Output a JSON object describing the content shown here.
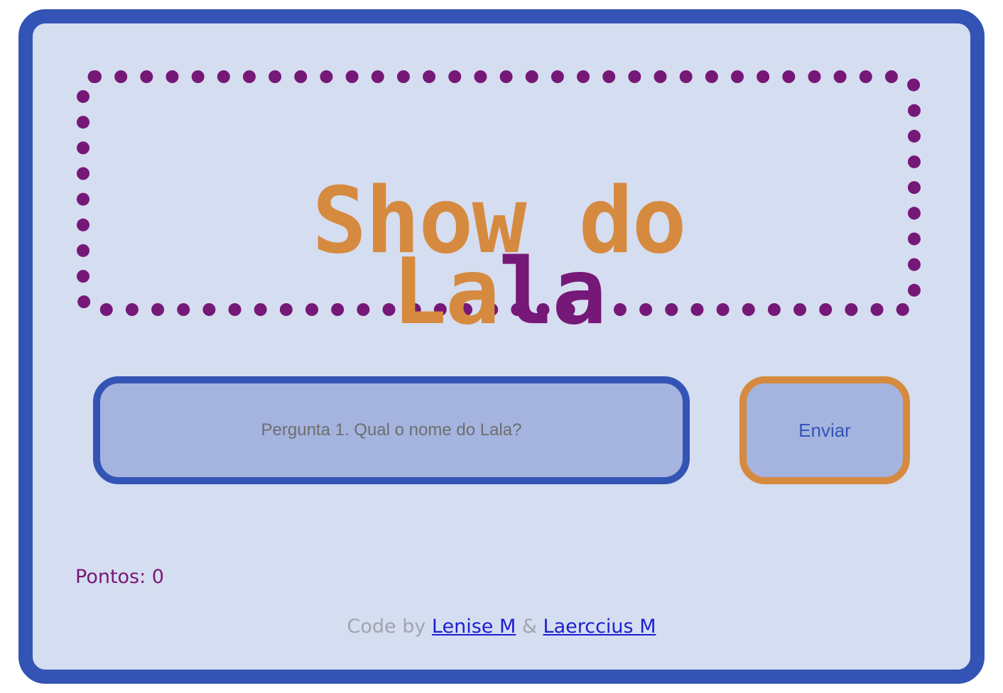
{
  "title": {
    "line1": "Show do",
    "line2_part1": "La",
    "line2_part2": "la",
    "line2_part3": "la"
  },
  "question": {
    "placeholder": "Pergunta 1. Qual o nome do Lala?",
    "value": ""
  },
  "send_button": {
    "label": "Enviar"
  },
  "score": {
    "text": "Pontos: 0"
  },
  "credits": {
    "prefix": "Code by",
    "author1": "Lenise M",
    "separator": "&",
    "author2": "Laerccius M"
  },
  "colors": {
    "frame_border": "#3354b5",
    "background": "#d5ddf0",
    "purple": "#761878",
    "orange": "#d68a3f",
    "input_fill": "#a4b4df"
  }
}
